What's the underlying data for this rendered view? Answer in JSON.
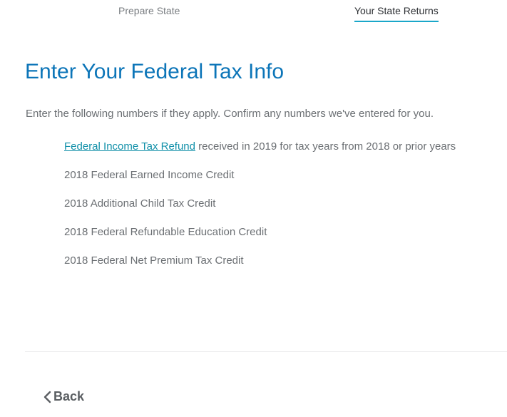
{
  "tabs": [
    {
      "label": "Prepare State",
      "active": false
    },
    {
      "label": "Your State Returns",
      "active": true
    }
  ],
  "page": {
    "title": "Enter Your Federal Tax Info",
    "intro": "Enter the following numbers if they apply. Confirm any numbers we've entered for you."
  },
  "items": {
    "refund_link": "Federal Income Tax Refund",
    "refund_suffix": " received in 2019 for tax years from 2018 or prior years",
    "earned_income": "2018 Federal Earned Income Credit",
    "child_tax": "2018 Additional Child Tax Credit",
    "education": "2018 Federal Refundable Education Credit",
    "premium": "2018 Federal Net Premium Tax Credit"
  },
  "footer": {
    "back_label": "Back",
    "back_icon": "chevron-left-icon"
  },
  "colors": {
    "title": "#0c75b8",
    "link": "#0f8fa8",
    "active_tab_underline": "#1aa7c9"
  }
}
